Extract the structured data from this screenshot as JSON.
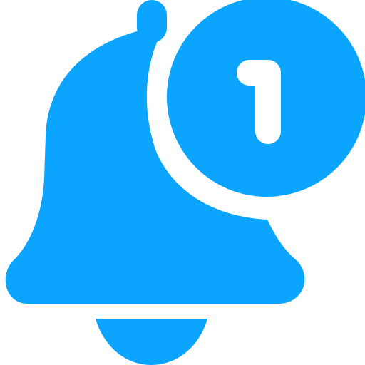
{
  "icon": {
    "name": "notification-bell-icon",
    "color": "#0ba4ff",
    "background": "#ffffff"
  },
  "badge": {
    "count": "1"
  }
}
